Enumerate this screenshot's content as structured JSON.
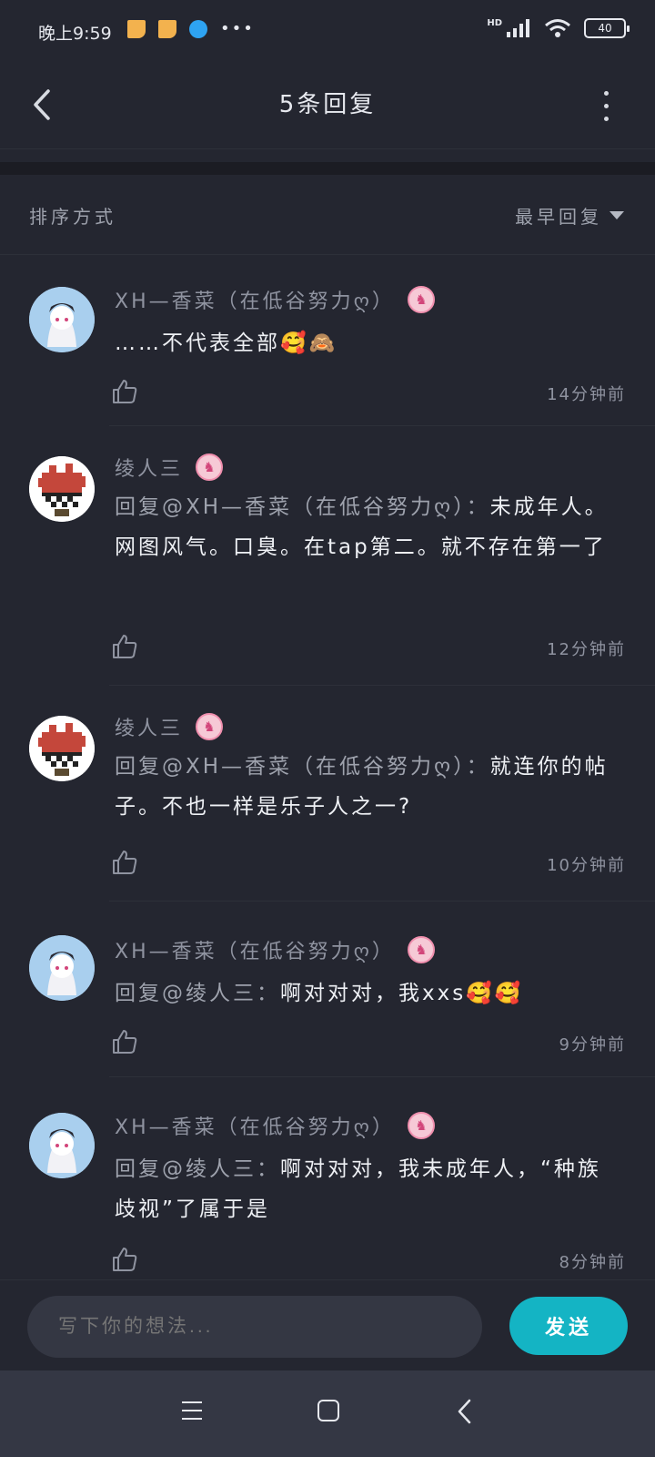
{
  "status_bar": {
    "time": "晚上9:59",
    "network": "HD",
    "battery": "40",
    "icons": [
      "note-icon",
      "note-icon",
      "browser-icon",
      "more-dots-icon",
      "signal-icon",
      "wifi-icon",
      "battery-icon"
    ]
  },
  "header": {
    "title": "5条回复",
    "back_icon": "chevron-left-icon",
    "more_icon": "more-vertical-icon"
  },
  "sort": {
    "label": "排序方式",
    "value": "最早回复"
  },
  "replies": [
    {
      "name": "XH—香菜（在低谷努力ღ）",
      "avatar": "girl-avatar",
      "content": "……不代表全部🥰🙈",
      "time": "14分钟前"
    },
    {
      "name": "绫人三",
      "avatar": "pixel-avatar",
      "mention": "回复@XH—香菜（在低谷努力ღ）：",
      "content": "未成年人。网图风气。口臭。在tap第二。就不存在第一了",
      "time": "12分钟前"
    },
    {
      "name": "绫人三",
      "avatar": "pixel-avatar",
      "mention": "回复@XH—香菜（在低谷努力ღ）：",
      "content": "就连你的帖子。不也一样是乐子人之一?",
      "time": "10分钟前"
    },
    {
      "name": "XH—香菜（在低谷努力ღ）",
      "avatar": "girl-avatar",
      "mention": "回复@绫人三：",
      "content": "啊对对对，我xxs🥰🥰",
      "time": "9分钟前"
    },
    {
      "name": "XH—香菜（在低谷努力ღ）",
      "avatar": "girl-avatar",
      "mention": "回复@绫人三：",
      "content": "啊对对对，我未成年人，“种族歧视”了属于是",
      "time": "8分钟前"
    }
  ],
  "composer": {
    "placeholder": "写下你的想法...",
    "send_label": "发送"
  },
  "colors": {
    "background": "#242630",
    "accent": "#14b4c4",
    "badge": "#f6c9d6"
  }
}
